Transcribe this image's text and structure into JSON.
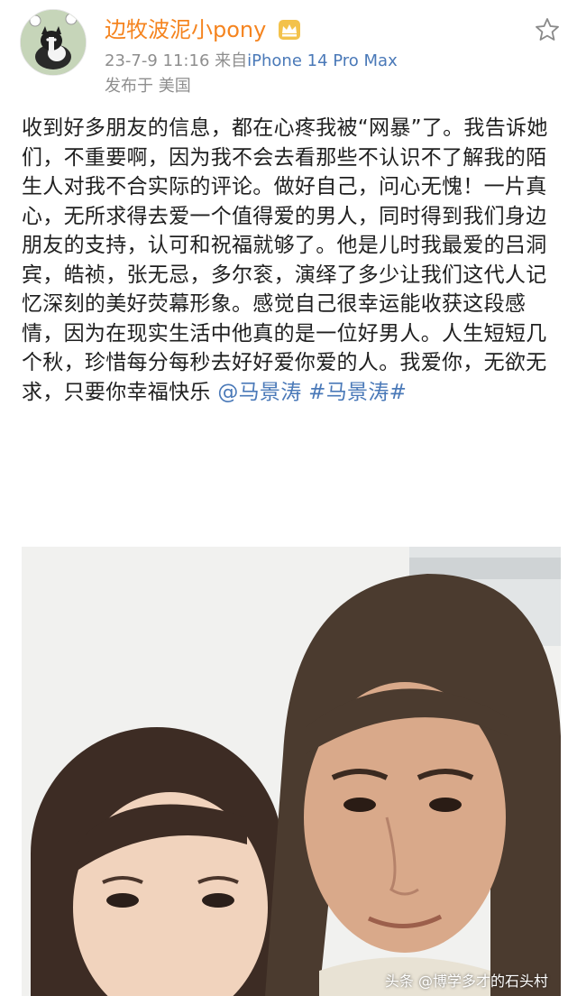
{
  "post": {
    "username": "边牧波泥小pony",
    "date": "23-7-9 11:16",
    "source_prefix": "来自",
    "device": "iPhone 14 Pro Max",
    "location": "发布于 美国",
    "text": "收到好多朋友的信息，都在心疼我被“网暴”了。我告诉她们，不重要啊，因为我不会去看那些不认识不了解我的陌生人对我不合实际的评论。做好自己，问心无愧！一片真心，无所求得去爱一个值得爱的男人，同时得到我们身边朋友的支持，认可和祝福就够了。他是儿时我最爱的吕洞宾，皓祯，张无忌，多尔衮，演绎了多少让我们这代人记忆深刻的美好荧幕形象。感觉自己很幸运能收获这段感情，因为在现实生活中他真的是一位好男人。人生短短几个秋，珍惜每分每秒去好好爱你爱的人。我爱你，无欲无求，只要你幸福快乐",
    "mention": "@马景涛",
    "hashtag": "#马景涛#"
  },
  "icons": {
    "avatar": "dog-avatar",
    "vip": "crown-vip-icon",
    "favorite": "star-icon"
  },
  "watermark": "头条 @博学多才的石头村",
  "colors": {
    "username": "#f5841f",
    "link": "#4a79b8",
    "meta": "#8e8e8e"
  }
}
